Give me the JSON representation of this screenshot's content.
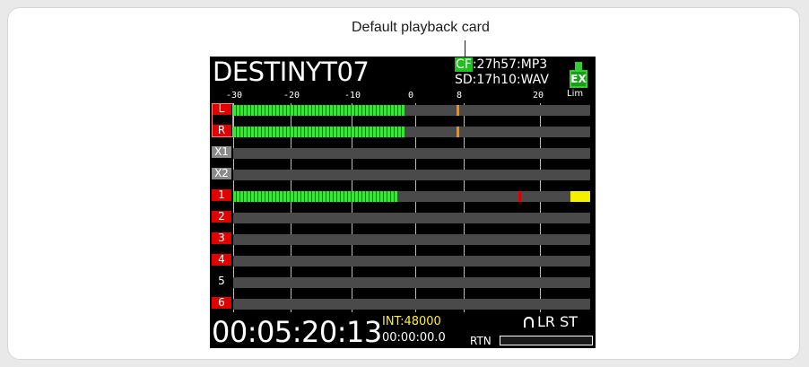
{
  "callout": {
    "label": "Default playback card"
  },
  "screen": {
    "title": "DESTINYT07",
    "card1_tag": "CF",
    "card1_rest": ":27h57:MP3",
    "card2": "SD:17h10:WAV",
    "ex_badge": "EX",
    "lim_label": "Lim",
    "ticks": [
      "-30",
      "-20",
      "-10",
      "0",
      "8",
      "20"
    ],
    "channels": [
      {
        "label": "L",
        "style": "red",
        "level": 0.48,
        "peak": 0.625,
        "peak_color": "#ff8a00",
        "clip": false
      },
      {
        "label": "R",
        "style": "red",
        "level": 0.48,
        "peak": 0.625,
        "peak_color": "#ff8a00",
        "clip": false
      },
      {
        "label": "X1",
        "style": "gray",
        "level": 0,
        "peak": null,
        "clip": false
      },
      {
        "label": "X2",
        "style": "gray",
        "level": 0,
        "peak": null,
        "clip": false
      },
      {
        "label": "1",
        "style": "red",
        "level": 0.46,
        "peak": 0.8,
        "peak_color": "#dd0000",
        "clip": true
      },
      {
        "label": "2",
        "style": "red",
        "level": 0,
        "peak": null,
        "clip": false
      },
      {
        "label": "3",
        "style": "red",
        "level": 0,
        "peak": null,
        "clip": false
      },
      {
        "label": "4",
        "style": "red",
        "level": 0,
        "peak": null,
        "clip": false
      },
      {
        "label": "5",
        "style": "none",
        "level": 0,
        "peak": null,
        "clip": false
      },
      {
        "label": "6",
        "style": "red",
        "level": 0,
        "peak": null,
        "clip": false
      }
    ],
    "timecode": "00:05:20:13",
    "int_rate": "INT:48000",
    "sub_time": "00:00:00.0",
    "monitor": "LR ST",
    "rtn_label": "RTN",
    "colors": {
      "meter_green": "#37e637",
      "clip_yellow": "#f4f000",
      "label_red": "#e00000",
      "card_green": "#20c020"
    }
  }
}
